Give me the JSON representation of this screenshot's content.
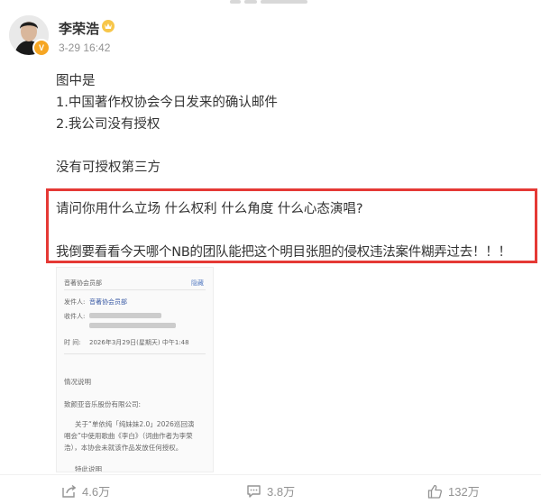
{
  "post": {
    "author": "李荣浩",
    "timestamp": "3-29 16:42",
    "lines": [
      "图中是",
      "1.中国著作权协会今日发来的确认邮件",
      "2.我公司没有授权",
      "没有可授权第三方",
      "请问你用什么立场 什么权利 什么角度 什么心态演唱?",
      "我倒要看看今天哪个NB的团队能把这个明目张胆的侵权违法案件糊弄过去！！！"
    ]
  },
  "document": {
    "header_left": "音著协会员部",
    "header_right": "隐藏",
    "sender_label": "发件人:",
    "sender": "音著协会员部",
    "recipient_label": "收件人:",
    "time_label": "时 间:",
    "time": "2026年3月29日(星期天) 中午1:48",
    "section_title": "情况说明",
    "salutation": "致颜亚音乐股份有限公司:",
    "body_1": "关于“单依纯「纯妹妹2.0」2026巡回演",
    "body_2": "唱会”中使用歌曲《李白》（词曲作者为李荣",
    "body_3": "浩），本协会未就该作品发放任何授权。",
    "body_4": "特此说明"
  },
  "stats": {
    "reposts": "4.6万",
    "comments": "3.8万",
    "likes": "132万"
  },
  "colors": {
    "highlight_border": "#e53935",
    "verify_badge": "#f6a623",
    "meta_text": "#939393"
  }
}
